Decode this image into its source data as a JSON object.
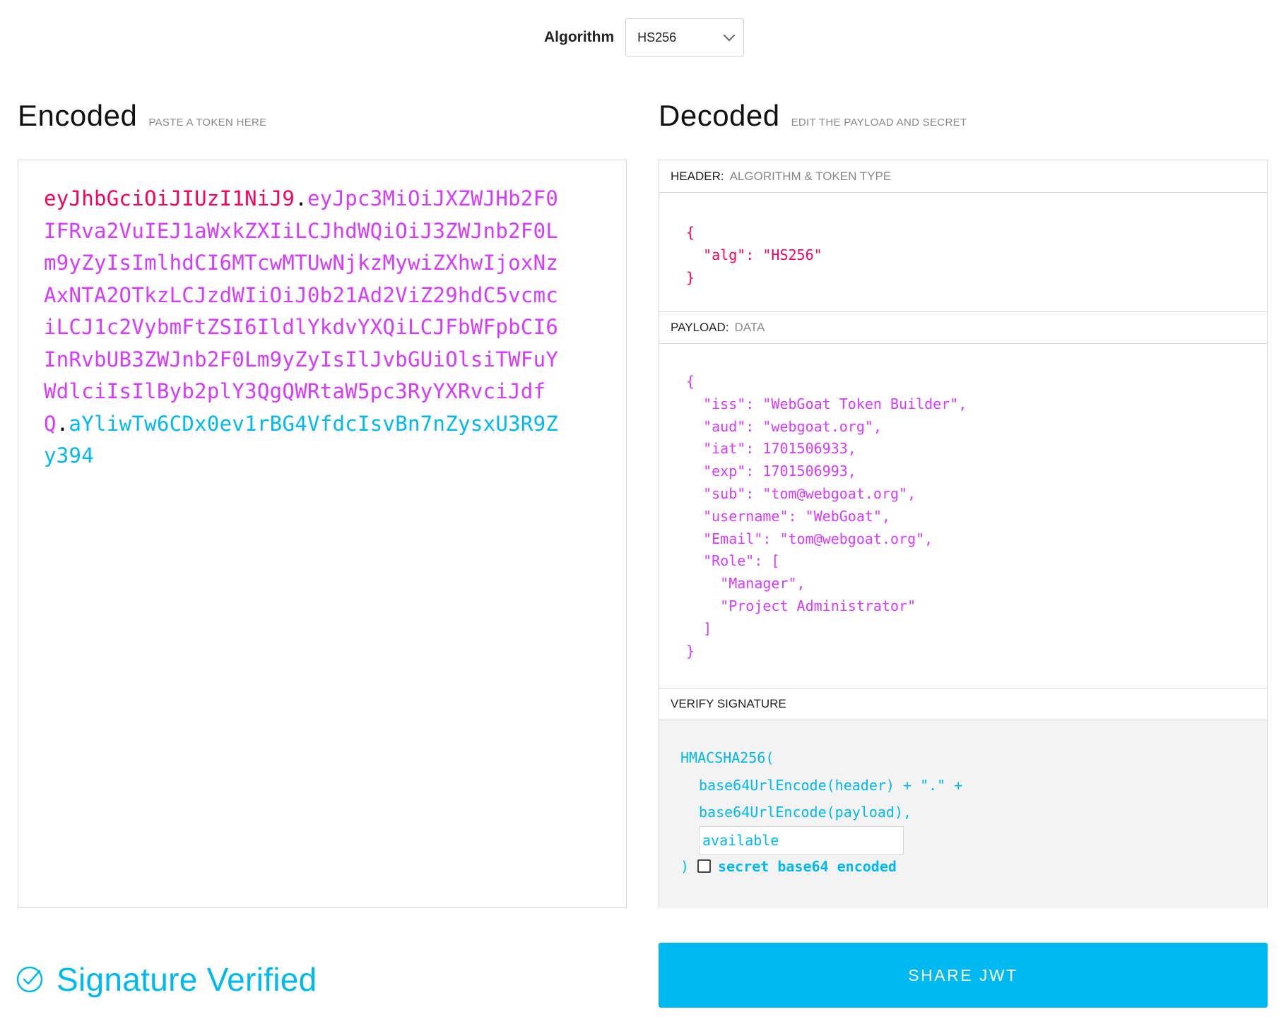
{
  "algorithm": {
    "label": "Algorithm",
    "selected": "HS256"
  },
  "encoded": {
    "title": "Encoded",
    "subtitle": "PASTE A TOKEN HERE",
    "token_header": "eyJhbGciOiJIUzI1NiJ9",
    "token_payload": "eyJpc3MiOiJXZWJHb2F0IFRva2VuIEJ1aWxkZXIiLCJhdWQiOiJ3ZWJnb2F0Lm9yZyIsImlhdCI6MTcwMTUwNjkzMywiZXhwIjoxNzAxNTA2OTkzLCJzdWIiOiJ0b21Ad2ViZ29hdC5vcmciLCJ1c2VybmFtZSI6IldlYkdvYXQiLCJFbWFpbCI6InRvbUB3ZWJnb2F0Lm9yZyIsIlJvbGUiOlsiTWFuYWdlciIsIlByb2plY3QgQWRtaW5pc3RyYXRvciJdfQ",
    "token_signature": "aYliwTw6CDx0ev1rBG4VfdcIsvBn7nZysxU3R9Zy394",
    "dot": "."
  },
  "decoded": {
    "title": "Decoded",
    "subtitle": "EDIT THE PAYLOAD AND SECRET",
    "header_section": {
      "label": "HEADER:",
      "sublabel": "ALGORITHM & TOKEN TYPE"
    },
    "header_json": "{\n  \"alg\": \"HS256\"\n}",
    "payload_section": {
      "label": "PAYLOAD:",
      "sublabel": "DATA"
    },
    "payload_json": "{\n  \"iss\": \"WebGoat Token Builder\",\n  \"aud\": \"webgoat.org\",\n  \"iat\": 1701506933,\n  \"exp\": 1701506993,\n  \"sub\": \"tom@webgoat.org\",\n  \"username\": \"WebGoat\",\n  \"Email\": \"tom@webgoat.org\",\n  \"Role\": [\n    \"Manager\",\n    \"Project Administrator\"\n  ]\n}",
    "verify_section": {
      "label": "VERIFY SIGNATURE"
    },
    "verify": {
      "fn_open": "HMACSHA256(",
      "line_header": "base64UrlEncode(header) + \".\" +",
      "line_payload": "base64UrlEncode(payload),",
      "secret_value": "available",
      "fn_close": ")",
      "checkbox_label": "secret base64 encoded"
    }
  },
  "status": {
    "text": "Signature Verified"
  },
  "share_button": {
    "label": "SHARE JWT"
  },
  "colors": {
    "header": "#fb015b",
    "payload": "#d63aff",
    "signature": "#00b9f1",
    "accent": "#00b9f1"
  },
  "icons": {
    "verified": "check-circle-icon",
    "dropdown": "chevron-down-icon"
  }
}
